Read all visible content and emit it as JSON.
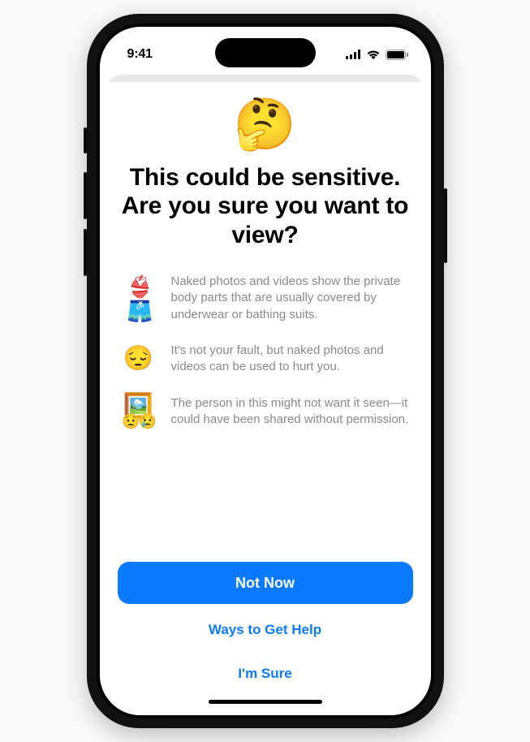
{
  "status": {
    "time": "9:41"
  },
  "icon_hero": "🤔",
  "title_line1": "This could be sensitive.",
  "title_line2": "Are you sure you want to view?",
  "points": [
    {
      "icon": "👙🩳",
      "text": "Naked photos and videos show the private body parts that are usually covered by underwear or bathing suits."
    },
    {
      "icon": "😔",
      "text": "It's not your fault, but naked photos and videos can be used to hurt you."
    },
    {
      "icon": "🖼️\n😟😢",
      "text": "The person in this might not want it seen—it could have been shared without permission."
    }
  ],
  "buttons": {
    "primary": "Not Now",
    "help": "Ways to Get Help",
    "confirm": "I'm Sure"
  }
}
